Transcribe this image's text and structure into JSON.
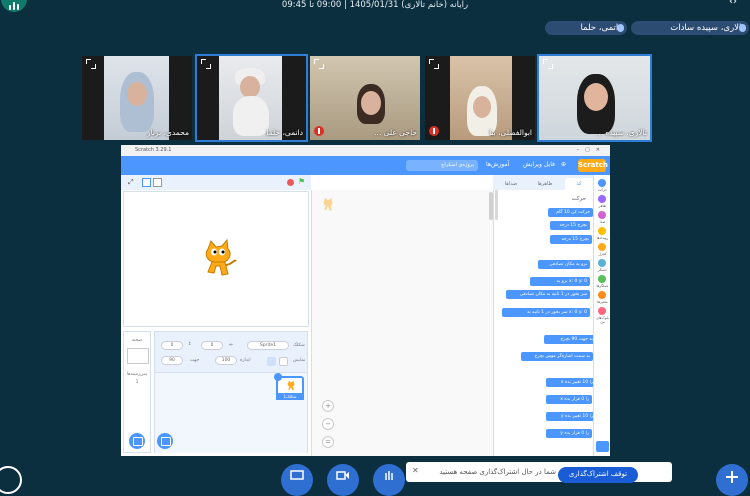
{
  "header": {
    "title": "رایانه (خانم تالاری) 1405/01/31 | 09:00 تا 09:45"
  },
  "pinned_users": [
    {
      "name": "تالاری، سپیده سادات"
    },
    {
      "name": "داتمی، حلما"
    }
  ],
  "participants": [
    {
      "name": "تالاری، سپیده ..."
    },
    {
      "name": "ابوالفضلی، بنا"
    },
    {
      "name": "حاجی علی ..."
    },
    {
      "name": "دانمی، حلما"
    },
    {
      "name": "محمدی، برنار"
    }
  ],
  "scratch": {
    "window_title": "Scratch 3.29.1",
    "logo": "Scratch",
    "menu": {
      "file": "فایل",
      "edit": "ویرایش",
      "tutorials": "آموزش‌ها",
      "project_title": "پروژه‌ی اسکراچ"
    },
    "tabs": {
      "code": "کد",
      "costumes": "ظاهرها",
      "sounds": "صداها"
    },
    "category_heading": "حرکت",
    "categories": [
      {
        "label": "حرکت",
        "color": "#4c97ff"
      },
      {
        "label": "ظاهر",
        "color": "#9966ff"
      },
      {
        "label": "صدا",
        "color": "#cf63cf"
      },
      {
        "label": "رویدادها",
        "color": "#ffbf00"
      },
      {
        "label": "کنترل",
        "color": "#ffab19"
      },
      {
        "label": "حسگر",
        "color": "#5cb1d6"
      },
      {
        "label": "عملگرها",
        "color": "#59c059"
      },
      {
        "label": "متغیرها",
        "color": "#ff8c1a"
      },
      {
        "label": "بلوک‌های من",
        "color": "#ff6680"
      }
    ],
    "blocks": [
      {
        "text": "حرکت کن 10 گام"
      },
      {
        "text": "بچرخ 15 درجه"
      },
      {
        "text": "بچرخ 15 درجه"
      },
      {
        "text": "برو به مکان تصادفی"
      },
      {
        "text": "برو به x: 0 y: 0"
      },
      {
        "text": "سر بخور در 1 ثانیه به مکان تصادفی"
      },
      {
        "text": "سر بخور در 1 ثانیه به x: 0 y: 0"
      },
      {
        "text": "به جهت 90 بچرخ"
      },
      {
        "text": "به سمت اشاره‌گر موس بچرخ"
      },
      {
        "text": "x را 10 تغییر بده"
      },
      {
        "text": "x را 0 قرار بده"
      },
      {
        "text": "y را 10 تغییر بده"
      },
      {
        "text": "y را 0 قرار بده"
      }
    ],
    "sprite_info": {
      "sprite_label": "شکلک",
      "sprite_name": "Sprite1",
      "x": "0",
      "y": "0",
      "show_label": "نمایش",
      "size_label": "اندازه",
      "size": "100",
      "direction_label": "جهت",
      "direction": "90"
    },
    "sprite_thumb_label": "شکلک1",
    "stage_label": "صحنه",
    "backdrops_label": "پس‌زمینه‌ها",
    "backdrops_count": "1"
  },
  "share": {
    "text": "شما در حال اشتراک‌گذاری صفحه هستید",
    "button": "توقف اشتراک‌گذاری"
  }
}
